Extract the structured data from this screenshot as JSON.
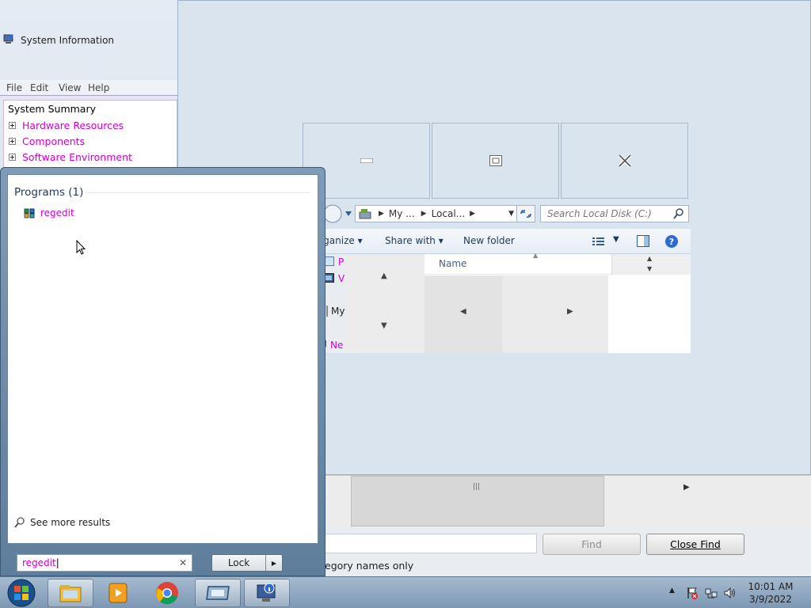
{
  "sysinfo": {
    "title": "System Information",
    "menu": [
      "File",
      "Edit",
      "View",
      "Help"
    ],
    "tree": {
      "root": "System Summary",
      "items": [
        "Hardware Resources",
        "Components",
        "Software Environment"
      ]
    }
  },
  "explorer": {
    "address": [
      "My ...",
      "Local..."
    ],
    "search_placeholder": "Search Local Disk (C:)",
    "toolbar": {
      "organize": "Organize",
      "share_with": "Share with",
      "new_folder": "New folder"
    },
    "nav_items": [
      "P",
      "V",
      "My",
      "Ne"
    ],
    "column_name": "Name"
  },
  "findbar": {
    "find_label": "Find",
    "close_find_label": "Close Find",
    "option_label": "egory names only"
  },
  "startmenu": {
    "section_title": "Programs (1)",
    "results": [
      "regedit"
    ],
    "see_more": "See more results",
    "search_value": "regedit",
    "lock_label": "Lock"
  },
  "taskbar": {
    "time": "10:01 AM",
    "date": "3/9/2022",
    "apps": [
      "start-orb",
      "windows-explorer",
      "media-player",
      "chrome",
      "remote-desktop",
      "system-information"
    ]
  },
  "colors": {
    "link_magenta": "#d000d0",
    "window_pale": "#d9e4ef",
    "taskbar": "#8aa3be"
  }
}
